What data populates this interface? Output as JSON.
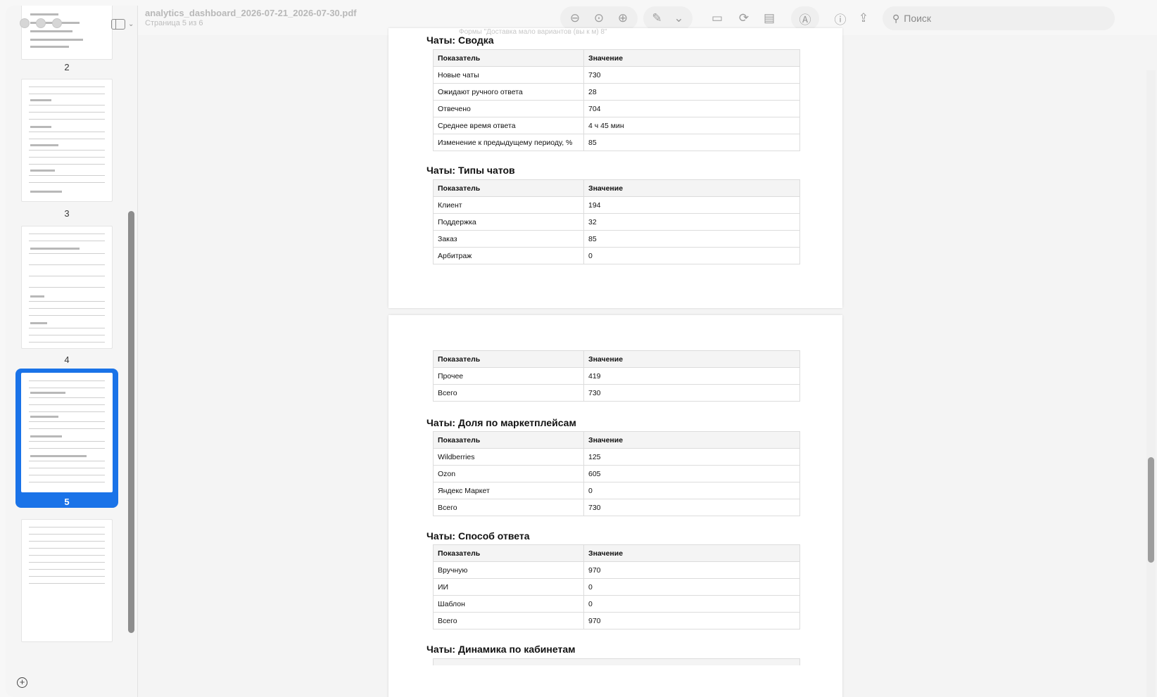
{
  "document": {
    "filename": "analytics_dashboard_2026-07-21_2026-07-30.pdf",
    "page_indicator": "Страница 5 из 6"
  },
  "toolbar": {
    "search_placeholder": "Поиск",
    "icons": [
      "zoom-out-icon",
      "zoom-fit-icon",
      "zoom-in-icon",
      "pencil-icon",
      "chevron-down-icon",
      "signature-box-icon",
      "rotate-icon",
      "markup-icon",
      "pen-circle-icon",
      "info-icon",
      "share-icon",
      "search-icon"
    ]
  },
  "sidebar": {
    "thumbnails": [
      {
        "number": "2"
      },
      {
        "number": "3"
      },
      {
        "number": "4"
      },
      {
        "number": "5",
        "selected": true
      },
      {
        "number": ""
      }
    ]
  },
  "page_top_fragment": "Формы \"Доставка мало вариантов (вы к м) 8\"",
  "page1": {
    "sections": [
      {
        "title": "Чаты: Сводка",
        "header": [
          "Показатель",
          "Значение"
        ],
        "rows": [
          [
            "Новые чаты",
            "730"
          ],
          [
            "Ожидают ручного ответа",
            "28"
          ],
          [
            "Отвечено",
            "704"
          ],
          [
            "Среднее время ответа",
            "4 ч 45 мин"
          ],
          [
            "Изменение к предыдущему периоду, %",
            "85"
          ]
        ]
      },
      {
        "title": "Чаты: Типы чатов",
        "header": [
          "Показатель",
          "Значение"
        ],
        "rows": [
          [
            "Клиент",
            "194"
          ],
          [
            "Поддержка",
            "32"
          ],
          [
            "Заказ",
            "85"
          ],
          [
            "Арбитраж",
            "0"
          ]
        ]
      }
    ]
  },
  "page2": {
    "continued_table": {
      "header": [
        "Показатель",
        "Значение"
      ],
      "rows": [
        [
          "Прочее",
          "419"
        ],
        [
          "Всего",
          "730"
        ]
      ]
    },
    "sections": [
      {
        "title": "Чаты: Доля по маркетплейсам",
        "header": [
          "Показатель",
          "Значение"
        ],
        "rows": [
          [
            "Wildberries",
            "125"
          ],
          [
            "Ozon",
            "605"
          ],
          [
            "Яндекс Маркет",
            "0"
          ],
          [
            "Всего",
            "730"
          ]
        ]
      },
      {
        "title": "Чаты: Способ ответа",
        "header": [
          "Показатель",
          "Значение"
        ],
        "rows": [
          [
            "Вручную",
            "970"
          ],
          [
            "ИИ",
            "0"
          ],
          [
            "Шаблон",
            "0"
          ],
          [
            "Всего",
            "970"
          ]
        ]
      }
    ],
    "last_title": "Чаты: Динамика по кабинетам"
  }
}
